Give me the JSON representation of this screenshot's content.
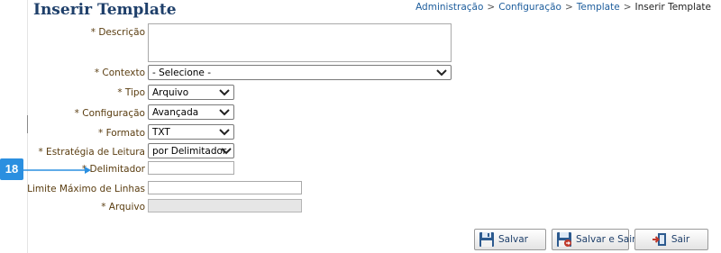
{
  "page": {
    "title": "Inserir Template",
    "breadcrumb": [
      "Administração",
      "Configuração",
      "Template",
      "Inserir Template"
    ],
    "breadcrumb_separator": ">"
  },
  "callout": {
    "number": "18",
    "color": "#2b8fe0"
  },
  "form": {
    "descricao": {
      "label": "* Descrição",
      "value": ""
    },
    "contexto": {
      "label": "* Contexto",
      "selected": "- Selecione -"
    },
    "tipo": {
      "label": "* Tipo",
      "selected": "Arquivo"
    },
    "configuracao": {
      "label": "* Configuração",
      "selected": "Avançada"
    },
    "formato": {
      "label": "* Formato",
      "selected": "TXT"
    },
    "estrategia": {
      "label": "* Estratégia de Leitura",
      "selected": "por Delimitador"
    },
    "delimitador": {
      "label": "* Delimitador",
      "value": ""
    },
    "limite": {
      "label": "Limite Máximo de Linhas",
      "value": ""
    },
    "arquivo": {
      "label": "* Arquivo",
      "value": ""
    }
  },
  "buttons": {
    "salvar": "Salvar",
    "salvar_sair": "Salvar e Sair",
    "sair": "Sair"
  },
  "colors": {
    "title": "#1e3f6a",
    "label": "#5a3d10",
    "link": "#1d5d9c"
  },
  "icons": {
    "salvar": "floppy-disk-icon",
    "salvar_sair": "floppy-disk-exit-icon",
    "sair": "exit-door-icon"
  }
}
